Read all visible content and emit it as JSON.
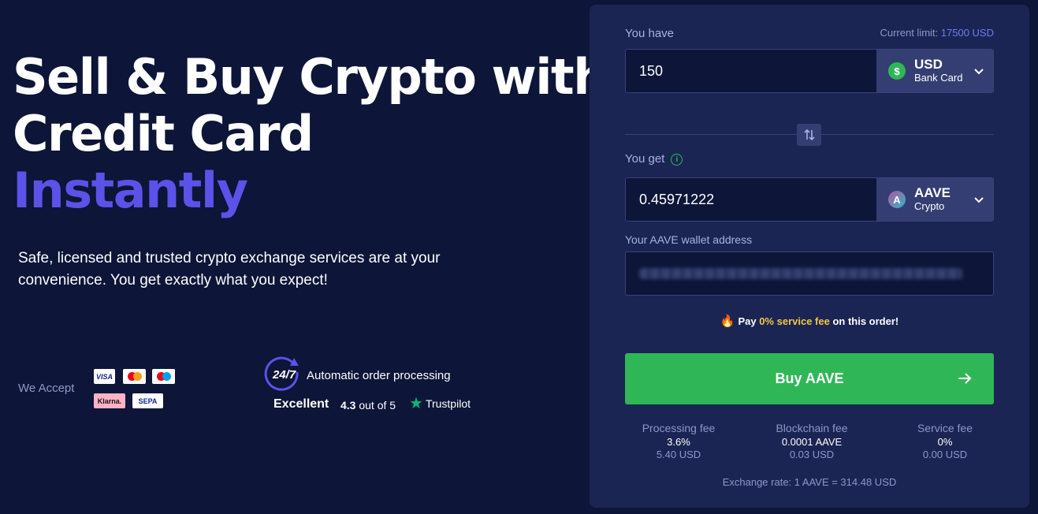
{
  "hero": {
    "line1": "Sell & Buy Crypto with",
    "line2": "Credit Card",
    "accent": "Instantly",
    "subtitle": "Safe, licensed and trusted crypto exchange services are at your convenience. You get exactly what you expect!"
  },
  "payments": {
    "label": "We Accept",
    "logos": [
      "VISA",
      "Mastercard",
      "Maestro",
      "Klarna.",
      "SEPA"
    ]
  },
  "trust": {
    "hours": "24/7",
    "automatic": "Automatic order processing",
    "rating_word": "Excellent",
    "score": "4.3",
    "score_suffix": "out of 5",
    "provider": "Trustpilot"
  },
  "exchange": {
    "you_have_label": "You have",
    "limit_label": "Current limit:",
    "limit_value": "17500 USD",
    "have_value": "150",
    "have_currency": "USD",
    "have_method": "Bank Card",
    "you_get_label": "You get",
    "get_value": "0.45971222",
    "get_currency": "AAVE",
    "get_method": "Crypto",
    "wallet_label": "Your AAVE wallet address",
    "fee_note_prefix": "Pay",
    "fee_note_highlight": "0% service fee",
    "fee_note_suffix": "on this order!",
    "buy_label": "Buy AAVE",
    "fees": [
      {
        "title": "Processing fee",
        "main": "3.6%",
        "usd": "5.40 USD"
      },
      {
        "title": "Blockchain fee",
        "main": "0.0001 AAVE",
        "usd": "0.03 USD"
      },
      {
        "title": "Service fee",
        "main": "0%",
        "usd": "0.00 USD"
      }
    ],
    "rate": "Exchange rate: 1 AAVE = 314.48 USD"
  },
  "colors": {
    "background": "#0d1538",
    "panel": "#1b2553",
    "accent": "#5b52e8",
    "buy_button": "#2fb757",
    "highlight": "#f2c744"
  }
}
